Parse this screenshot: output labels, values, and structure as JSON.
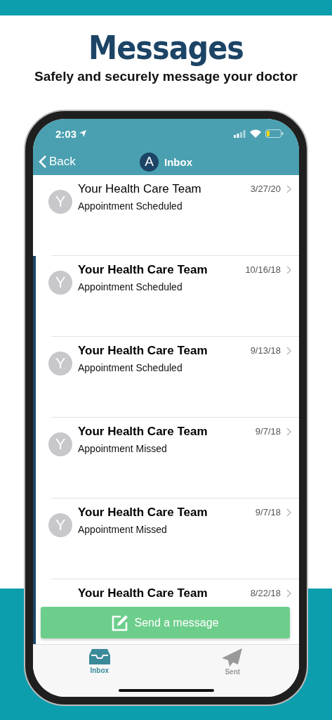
{
  "header": {
    "title": "Messages",
    "subtitle": "Safely and securely message your doctor"
  },
  "status_bar": {
    "time": "2:03"
  },
  "nav": {
    "back": "Back",
    "avatar": "A",
    "title": "Inbox"
  },
  "messages": [
    {
      "avatar": "Y",
      "sender": "Your Health Care Team",
      "subject": "Appointment Scheduled",
      "date": "3/27/20",
      "unread": false
    },
    {
      "avatar": "Y",
      "sender": "Your Health Care Team",
      "subject": "Appointment Scheduled",
      "date": "10/16/18",
      "unread": true
    },
    {
      "avatar": "Y",
      "sender": "Your Health Care Team",
      "subject": "Appointment Scheduled",
      "date": "9/13/18",
      "unread": true
    },
    {
      "avatar": "Y",
      "sender": "Your Health Care Team",
      "subject": "Appointment Missed",
      "date": "9/7/18",
      "unread": true
    },
    {
      "avatar": "Y",
      "sender": "Your Health Care Team",
      "subject": "Appointment Missed",
      "date": "9/7/18",
      "unread": true
    },
    {
      "sender": "Your Health Care Team",
      "date": "8/22/18",
      "unread": true
    }
  ],
  "send_button": "Send a message",
  "tabs": [
    {
      "label": "Inbox",
      "selected": true
    },
    {
      "label": "Sent",
      "selected": false
    }
  ]
}
